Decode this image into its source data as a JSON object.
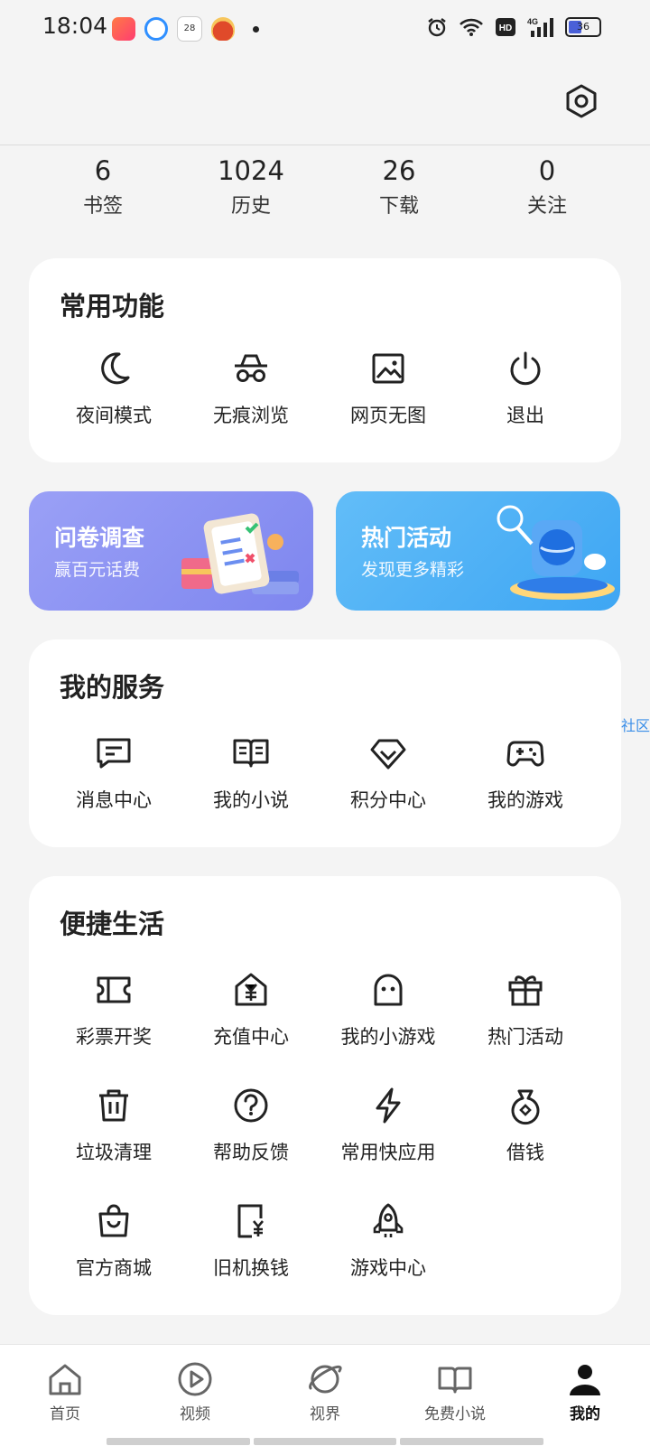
{
  "status_bar": {
    "time": "18:04",
    "notification_icons": [
      "kuaishou-icon",
      "browser-icon",
      "calendar-icon",
      "news-icon"
    ],
    "system_icons": [
      "alarm-icon",
      "wifi-icon",
      "hd-icon",
      "signal-4g-icon"
    ],
    "battery": "36"
  },
  "header": {
    "settings_icon": "settings-gear-icon"
  },
  "stats": [
    {
      "value": "6",
      "label": "书签"
    },
    {
      "value": "1024",
      "label": "历史"
    },
    {
      "value": "26",
      "label": "下载"
    },
    {
      "value": "0",
      "label": "关注"
    }
  ],
  "common_functions": {
    "title": "常用功能",
    "items": [
      {
        "label": "夜间模式",
        "icon": "moon-icon"
      },
      {
        "label": "无痕浏览",
        "icon": "incognito-icon"
      },
      {
        "label": "网页无图",
        "icon": "image-icon"
      },
      {
        "label": "退出",
        "icon": "power-icon"
      }
    ]
  },
  "banners": [
    {
      "title": "问卷调查",
      "subtitle": "赢百元话费",
      "color": "#8a8ff2"
    },
    {
      "title": "热门活动",
      "subtitle": "发现更多精彩",
      "color": "#59b3f5"
    }
  ],
  "side_tag": "流星社区",
  "my_services": {
    "title": "我的服务",
    "items": [
      {
        "label": "消息中心",
        "icon": "message-icon"
      },
      {
        "label": "我的小说",
        "icon": "book-icon"
      },
      {
        "label": "积分中心",
        "icon": "diamond-icon"
      },
      {
        "label": "我的游戏",
        "icon": "gamepad-icon"
      }
    ]
  },
  "convenient_life": {
    "title": "便捷生活",
    "items": [
      {
        "label": "彩票开奖",
        "icon": "ticket-icon"
      },
      {
        "label": "充值中心",
        "icon": "yuan-house-icon"
      },
      {
        "label": "我的小游戏",
        "icon": "ghost-icon"
      },
      {
        "label": "热门活动",
        "icon": "gift-icon"
      },
      {
        "label": "垃圾清理",
        "icon": "trash-icon"
      },
      {
        "label": "帮助反馈",
        "icon": "help-icon"
      },
      {
        "label": "常用快应用",
        "icon": "lightning-icon"
      },
      {
        "label": "借钱",
        "icon": "money-bag-icon"
      },
      {
        "label": "官方商城",
        "icon": "shopping-bag-icon"
      },
      {
        "label": "旧机换钱",
        "icon": "phone-yuan-icon"
      },
      {
        "label": "游戏中心",
        "icon": "rocket-icon"
      }
    ]
  },
  "bottom_nav": [
    {
      "label": "首页",
      "icon": "home-icon"
    },
    {
      "label": "视频",
      "icon": "play-icon"
    },
    {
      "label": "视界",
      "icon": "planet-icon"
    },
    {
      "label": "免费小说",
      "icon": "open-book-icon"
    },
    {
      "label": "我的",
      "icon": "person-icon",
      "active": true
    }
  ]
}
